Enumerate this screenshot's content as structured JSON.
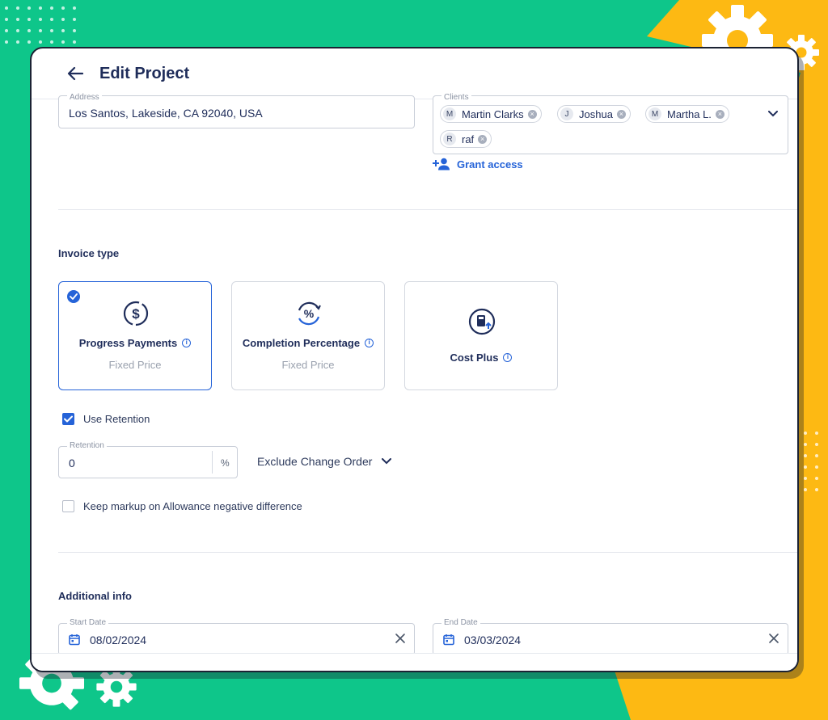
{
  "header": {
    "title": "Edit Project"
  },
  "address": {
    "label": "Address",
    "value": "Los Santos, Lakeside, CA 92040, USA"
  },
  "clients": {
    "label": "Clients",
    "chips": [
      {
        "initial": "M",
        "name": "Martin Clarks"
      },
      {
        "initial": "J",
        "name": "Joshua"
      },
      {
        "initial": "M",
        "name": "Martha L."
      },
      {
        "initial": "R",
        "name": "raf"
      }
    ],
    "grant_access_label": "Grant access"
  },
  "invoice": {
    "section_title": "Invoice type",
    "cards": [
      {
        "title": "Progress Payments",
        "subtitle": "Fixed Price",
        "selected": true
      },
      {
        "title": "Completion Percentage",
        "subtitle": "Fixed Price",
        "selected": false
      },
      {
        "title": "Cost Plus",
        "subtitle": "",
        "selected": false
      }
    ],
    "use_retention": {
      "label": "Use Retention",
      "checked": true
    },
    "retention": {
      "label": "Retention",
      "value": "0",
      "unit": "%"
    },
    "exclude_change_order": "Exclude Change Order",
    "keep_markup": {
      "label": "Keep markup on Allowance negative difference",
      "checked": false
    }
  },
  "additional": {
    "section_title": "Additional info",
    "start_date": {
      "label": "Start Date",
      "value": "08/02/2024"
    },
    "end_date": {
      "label": "End Date",
      "value": "03/03/2024"
    }
  },
  "colors": {
    "accent": "#2563d8",
    "background_green": "#0ec68a",
    "background_yellow": "#fdb913"
  }
}
